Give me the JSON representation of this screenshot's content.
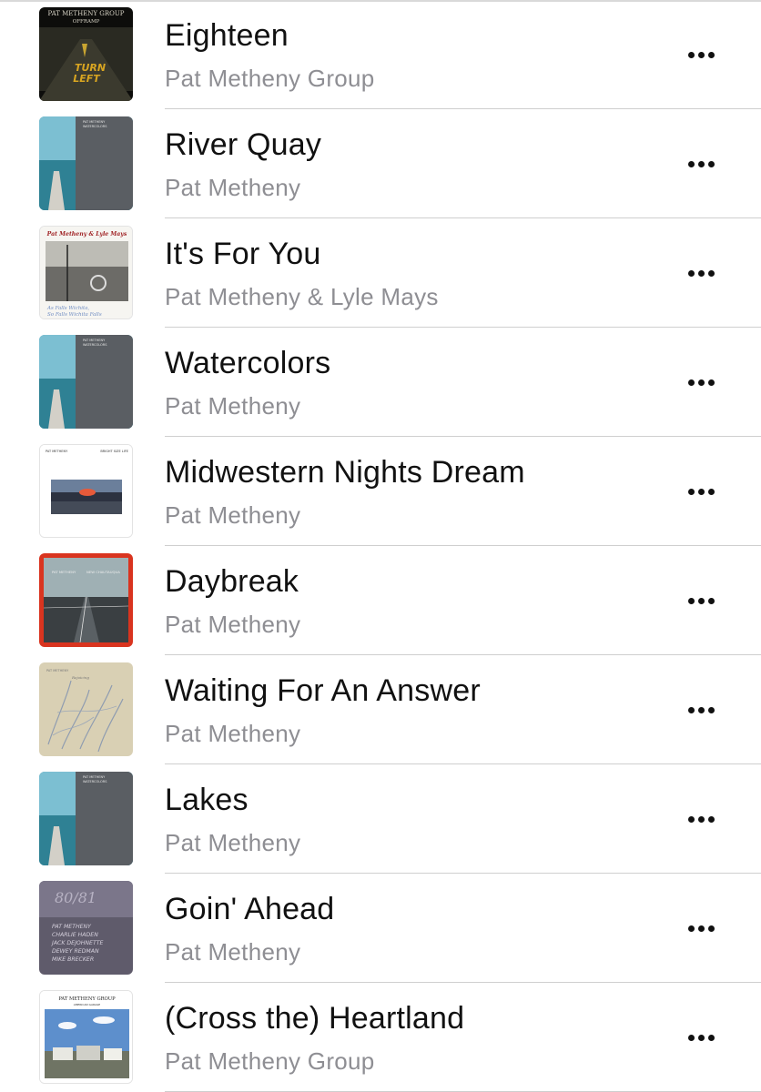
{
  "songs": [
    {
      "title": "Eighteen",
      "artist": "Pat Metheny Group",
      "artwork_icon": "offramp-album-art",
      "artwork_text": [
        "PAT METHENY GROUP",
        "OFFRAMP",
        "TURN",
        "LEFT"
      ]
    },
    {
      "title": "River Quay",
      "artist": "Pat Metheny",
      "artwork_icon": "watercolors-album-art",
      "artwork_text": [
        "PAT METHENY",
        "WATERCOLORS"
      ]
    },
    {
      "title": "It's For You",
      "artist": "Pat Metheny & Lyle Mays",
      "artwork_icon": "as-falls-wichita-album-art",
      "artwork_text": [
        "Pat Metheny & Lyle Mays",
        "As Falls Wichita,",
        "So Falls Wichita Falls"
      ]
    },
    {
      "title": "Watercolors",
      "artist": "Pat Metheny",
      "artwork_icon": "watercolors-album-art",
      "artwork_text": [
        "PAT METHENY",
        "WATERCOLORS"
      ]
    },
    {
      "title": "Midwestern Nights Dream",
      "artist": "Pat Metheny",
      "artwork_icon": "bright-size-life-album-art",
      "artwork_text": [
        "PAT METHENY",
        "BRIGHT SIZE LIFE"
      ]
    },
    {
      "title": "Daybreak",
      "artist": "Pat Metheny",
      "artwork_icon": "new-chautauqua-album-art",
      "artwork_text": [
        "PAT METHENY",
        "NEW CHAUTAUQUA"
      ]
    },
    {
      "title": "Waiting For An Answer",
      "artist": "Pat Metheny",
      "artwork_icon": "rejoicing-album-art",
      "artwork_text": [
        "PAT METHENY",
        "Rejoicing"
      ]
    },
    {
      "title": "Lakes",
      "artist": "Pat Metheny",
      "artwork_icon": "watercolors-album-art",
      "artwork_text": [
        "PAT METHENY",
        "WATERCOLORS"
      ]
    },
    {
      "title": "Goin' Ahead",
      "artist": "Pat Metheny",
      "artwork_icon": "80-81-album-art",
      "artwork_text": [
        "80/81",
        "PAT METHENY",
        "CHARLIE HADEN",
        "JACK DEJOHNETTE",
        "DEWEY REDMAN",
        "MIKE BRECKER"
      ]
    },
    {
      "title": "(Cross the) Heartland",
      "artist": "Pat Metheny Group",
      "artwork_icon": "american-garage-album-art",
      "artwork_text": [
        "PAT METHENY GROUP",
        "AMERICAN GARAGE"
      ]
    }
  ],
  "more_button_icon": "ellipsis-icon"
}
